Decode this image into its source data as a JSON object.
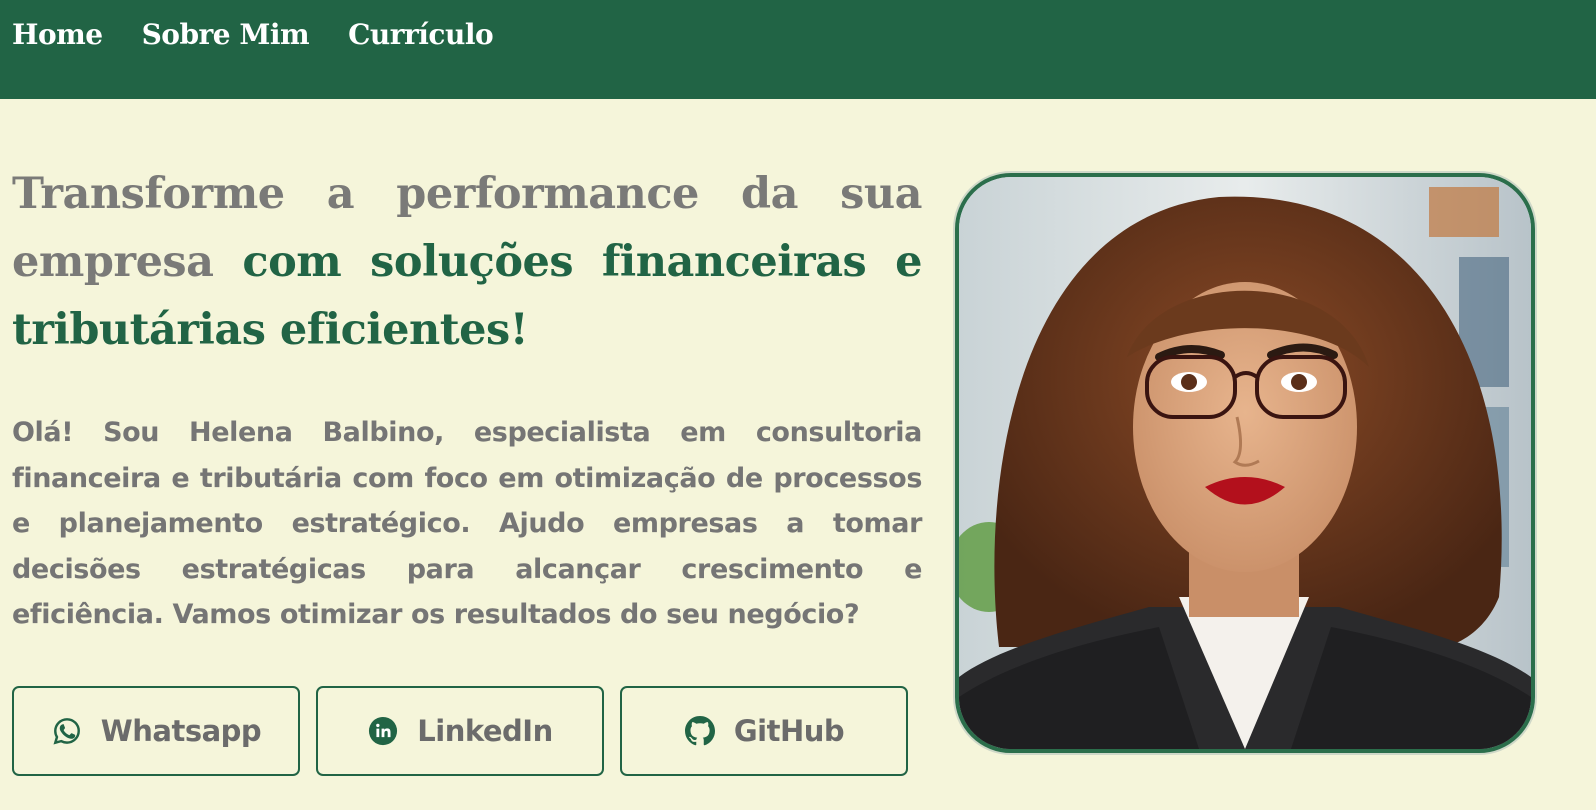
{
  "nav": {
    "items": [
      {
        "label": "Home"
      },
      {
        "label": "Sobre Mim"
      },
      {
        "label": "Currículo"
      }
    ]
  },
  "hero": {
    "headline_plain": "Transforme a performance da sua empresa",
    "headline_accent": "com soluções financeiras e tributárias eficientes!",
    "intro": "Olá! Sou Helena Balbino, especialista em consultoria financeira e tributária com foco em otimização de processos e planejamento estratégico. Ajudo empresas a tomar decisões estratégicas para alcançar crescimento e eficiência. Vamos otimizar os resultados do seu negócio?"
  },
  "buttons": [
    {
      "label": "Whatsapp",
      "icon": "whatsapp-icon"
    },
    {
      "label": "LinkedIn",
      "icon": "linkedin-icon"
    },
    {
      "label": "GitHub",
      "icon": "github-icon"
    }
  ],
  "colors": {
    "primary": "#216445",
    "background": "#f5f5da",
    "text_muted": "#7a7a78",
    "nav_text": "#ffffff"
  }
}
